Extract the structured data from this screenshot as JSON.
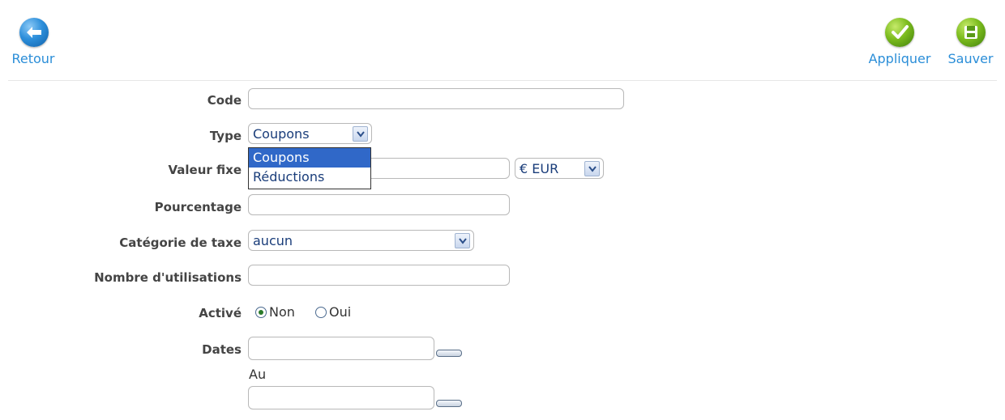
{
  "toolbar": {
    "back_label": "Retour",
    "apply_label": "Appliquer",
    "save_label": "Sauver",
    "back_icon": "back-arrow-icon",
    "apply_icon": "checkmark-icon",
    "save_icon": "floppy-disk-icon"
  },
  "form": {
    "code": {
      "label": "Code",
      "value": ""
    },
    "type": {
      "label": "Type",
      "value": "Coupons",
      "options": [
        "Coupons",
        "Réductions"
      ],
      "dropdown_open": true
    },
    "fixed_value": {
      "label": "Valeur fixe",
      "value": "",
      "currency": "€ EUR"
    },
    "percentage": {
      "label": "Pourcentage",
      "value": ""
    },
    "tax_category": {
      "label": "Catégorie de taxe",
      "value": "aucun"
    },
    "uses": {
      "label": "Nombre d'utilisations",
      "value": ""
    },
    "active": {
      "label": "Activé",
      "options": [
        {
          "label": "Non",
          "checked": true
        },
        {
          "label": "Oui",
          "checked": false
        }
      ]
    },
    "dates": {
      "label": "Dates",
      "from": "",
      "to_label": "Au",
      "to": ""
    }
  },
  "colors": {
    "link": "#2b8ed8",
    "dropdown_selected": "#3068c8",
    "back_button": "#2d8fdb",
    "action_button": "#7cbc1e"
  }
}
